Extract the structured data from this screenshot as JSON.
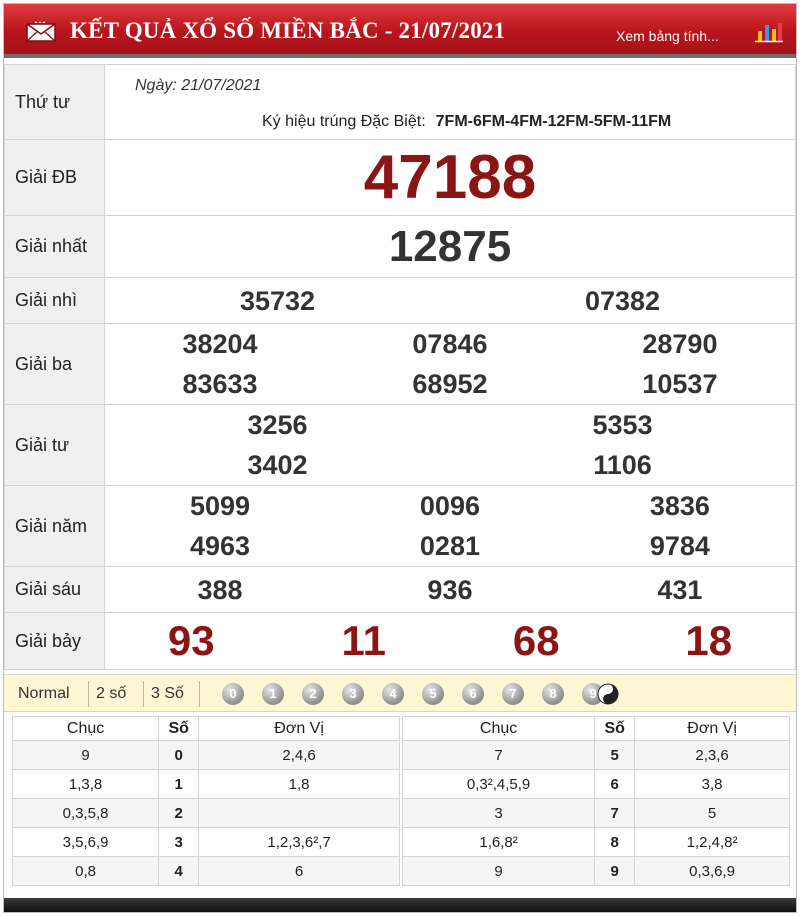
{
  "header": {
    "title": "KẾT QUẢ XỔ SỐ MIỀN BẮC - 21/07/2021",
    "link_label": "Xem bảng tính...",
    "brand_color": "#b9151c"
  },
  "info": {
    "weekday": "Thứ tư",
    "date": "Ngày: 21/07/2021",
    "special_code_label": "Ký hiệu trúng Đặc Biệt:",
    "special_code": "7FM-6FM-4FM-12FM-5FM-11FM"
  },
  "prizes": {
    "db": {
      "label": "Giải ĐB",
      "numbers": [
        "47188"
      ]
    },
    "g1": {
      "label": "Giải nhất",
      "numbers": [
        "12875"
      ]
    },
    "g2": {
      "label": "Giải nhì",
      "numbers": [
        "35732",
        "07382"
      ]
    },
    "g3": {
      "label": "Giải ba",
      "numbers": [
        "38204",
        "07846",
        "28790",
        "83633",
        "68952",
        "10537"
      ]
    },
    "g4": {
      "label": "Giải tư",
      "numbers": [
        "3256",
        "5353",
        "3402",
        "1106"
      ]
    },
    "g5": {
      "label": "Giải năm",
      "numbers": [
        "5099",
        "0096",
        "3836",
        "4963",
        "0281",
        "9784"
      ]
    },
    "g6": {
      "label": "Giải sáu",
      "numbers": [
        "388",
        "936",
        "431"
      ]
    },
    "g7": {
      "label": "Giải bảy",
      "numbers": [
        "93",
        "11",
        "68",
        "18"
      ]
    }
  },
  "toolbar": {
    "options": [
      "Normal",
      "2 số",
      "3 Số"
    ],
    "digit_balls": [
      "0",
      "1",
      "2",
      "3",
      "4",
      "5",
      "6",
      "7",
      "8",
      "9"
    ]
  },
  "loto": {
    "headers": [
      "Chục",
      "Số",
      "Đơn Vị"
    ],
    "left": [
      {
        "chuc": "9",
        "so": "0",
        "donvi": "2,4,6"
      },
      {
        "chuc": "1,3,8",
        "so": "1",
        "donvi": "1,8"
      },
      {
        "chuc": "0,3,5,8",
        "so": "2",
        "donvi": ""
      },
      {
        "chuc": "3,5,6,9",
        "so": "3",
        "donvi": "1,2,3,6²,7"
      },
      {
        "chuc": "0,8",
        "so": "4",
        "donvi": "6"
      }
    ],
    "right": [
      {
        "chuc": "7",
        "so": "5",
        "donvi": "2,3,6"
      },
      {
        "chuc": "0,3²,4,5,9",
        "so": "6",
        "donvi": "3,8"
      },
      {
        "chuc": "3",
        "so": "7",
        "donvi": "5"
      },
      {
        "chuc": "1,6,8²",
        "so": "8",
        "donvi": "1,2,4,8²"
      },
      {
        "chuc": "9",
        "so": "9",
        "donvi": "0,3,6,9"
      }
    ]
  }
}
